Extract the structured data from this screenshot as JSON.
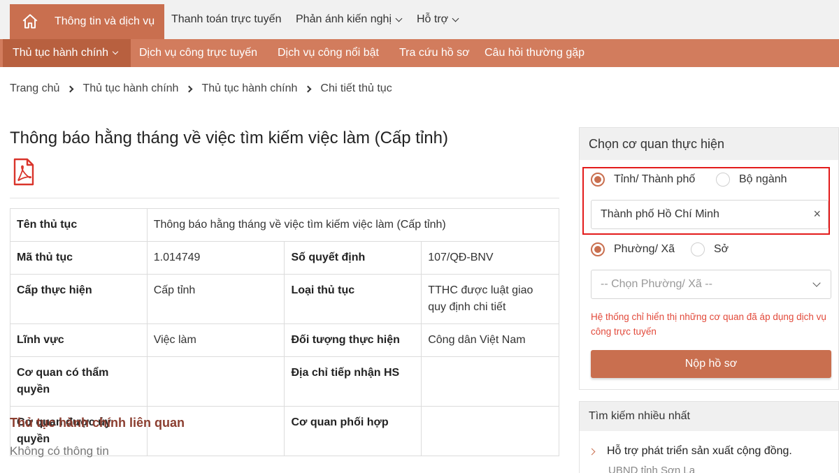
{
  "topnav": {
    "home_label": "Thông tin và dịch vụ",
    "items": [
      "Thanh toán trực tuyến",
      "Phản ánh kiến nghị",
      "Hỗ trợ"
    ]
  },
  "subnav": {
    "items": [
      "Thủ tục hành chính",
      "Dịch vụ công trực tuyến",
      "Dịch vụ công nổi bật",
      "Tra cứu hồ sơ",
      "Câu hỏi thường gặp"
    ]
  },
  "breadcrumb": [
    "Trang chủ",
    "Thủ tục hành chính",
    "Thủ tục hành chính",
    "Chi tiết thủ tục"
  ],
  "page_title": "Thông báo hằng tháng về việc tìm kiếm việc làm (Cấp tỉnh)",
  "table": {
    "ten_thu_tuc": {
      "label": "Tên thủ tục",
      "value": "Thông báo hằng tháng về việc tìm kiếm việc làm (Cấp tỉnh)"
    },
    "ma_thu_tuc": {
      "label": "Mã thủ tục",
      "value": "1.014749"
    },
    "so_quyet_dinh": {
      "label": "Số quyết định",
      "value": "107/QĐ-BNV"
    },
    "cap_thuc_hien": {
      "label": "Cấp thực hiện",
      "value": "Cấp tỉnh"
    },
    "loai_thu_tuc": {
      "label": "Loại thủ tục",
      "value": "TTHC được luật giao quy định chi tiết"
    },
    "linh_vuc": {
      "label": "Lĩnh vực",
      "value": "Việc làm"
    },
    "doi_tuong": {
      "label": "Đối tượng thực hiện",
      "value": "Công dân Việt Nam"
    },
    "co_quan_tham_quyen": {
      "label": "Cơ quan có thẩm quyền",
      "value": ""
    },
    "dia_chi_tiep_nhan": {
      "label": "Địa chỉ tiếp nhận HS",
      "value": ""
    },
    "co_quan_uy_quyen": {
      "label": "Cơ quan được ủy quyền",
      "value": ""
    },
    "co_quan_phoi_hop": {
      "label": "Cơ quan phối hợp",
      "value": ""
    }
  },
  "related": {
    "title": "Thủ tục hành chính liên quan",
    "empty": "Không có thông tin"
  },
  "panel": {
    "title": "Chọn cơ quan thực hiện",
    "radio_tinh": "Tỉnh/ Thành phố",
    "radio_bo": "Bộ ngành",
    "selected_city": "Thành phố Hồ Chí Minh",
    "radio_phuong": "Phường/ Xã",
    "radio_so": "Sở",
    "ward_placeholder": "-- Chọn Phường/ Xã --",
    "notice": "Hệ thống chỉ hiển thị những cơ quan đã áp dụng dịch vụ công trực tuyến",
    "submit": "Nộp hồ sơ"
  },
  "most_searched": {
    "title": "Tìm kiếm nhiều nhất",
    "item": "Hỗ trợ phát triển sản xuất cộng đồng.",
    "item_sub": "UBND tỉnh Sơn La"
  },
  "colors": {
    "primary": "#c96f4f",
    "subnav": "#d27c5d",
    "subnav_active": "#b8603f",
    "highlight": "#e31b1b",
    "notice": "#e24a3b"
  }
}
